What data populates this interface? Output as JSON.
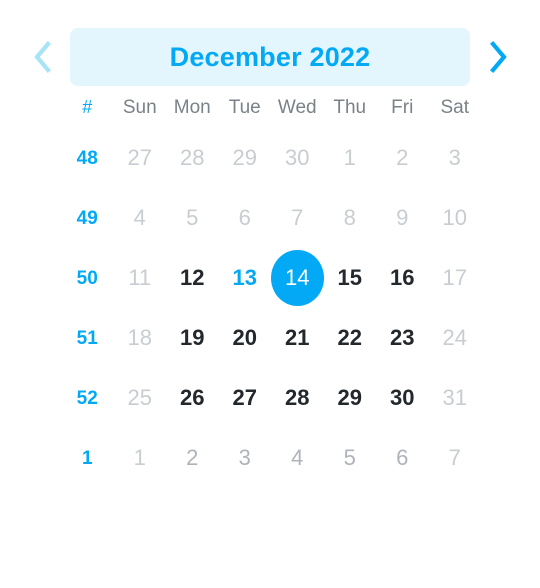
{
  "header": {
    "prev_icon": "chevron-left-icon",
    "next_icon": "chevron-right-icon",
    "title": "December 2022",
    "month": "December",
    "year": "2022"
  },
  "colors": {
    "accent": "#03a9f4",
    "accent_muted": "#a8e3f8",
    "header_pill_bg": "#e3f5fd",
    "day_text": "#23282c",
    "day_muted": "#c8cdd1",
    "dow_text": "#7a8288",
    "selected_text": "#ffffff",
    "background": "#ffffff"
  },
  "weekday_header": {
    "week_number_label": "#",
    "days": [
      "Sun",
      "Mon",
      "Tue",
      "Wed",
      "Thu",
      "Fri",
      "Sat"
    ]
  },
  "selected_date": "14",
  "today_date": "13",
  "weeks": [
    {
      "week_number": "48",
      "days": [
        {
          "label": "27",
          "state": "muted"
        },
        {
          "label": "28",
          "state": "muted"
        },
        {
          "label": "29",
          "state": "muted"
        },
        {
          "label": "30",
          "state": "muted"
        },
        {
          "label": "1",
          "state": "muted"
        },
        {
          "label": "2",
          "state": "muted"
        },
        {
          "label": "3",
          "state": "muted"
        }
      ]
    },
    {
      "week_number": "49",
      "days": [
        {
          "label": "4",
          "state": "muted"
        },
        {
          "label": "5",
          "state": "muted"
        },
        {
          "label": "6",
          "state": "muted"
        },
        {
          "label": "7",
          "state": "muted"
        },
        {
          "label": "8",
          "state": "muted"
        },
        {
          "label": "9",
          "state": "muted"
        },
        {
          "label": "10",
          "state": "muted"
        }
      ]
    },
    {
      "week_number": "50",
      "days": [
        {
          "label": "11",
          "state": "muted"
        },
        {
          "label": "12",
          "state": "normal"
        },
        {
          "label": "13",
          "state": "today"
        },
        {
          "label": "14",
          "state": "selected"
        },
        {
          "label": "15",
          "state": "normal"
        },
        {
          "label": "16",
          "state": "normal"
        },
        {
          "label": "17",
          "state": "muted"
        }
      ]
    },
    {
      "week_number": "51",
      "days": [
        {
          "label": "18",
          "state": "muted"
        },
        {
          "label": "19",
          "state": "normal"
        },
        {
          "label": "20",
          "state": "normal"
        },
        {
          "label": "21",
          "state": "normal"
        },
        {
          "label": "22",
          "state": "normal"
        },
        {
          "label": "23",
          "state": "normal"
        },
        {
          "label": "24",
          "state": "muted"
        }
      ]
    },
    {
      "week_number": "52",
      "days": [
        {
          "label": "25",
          "state": "muted"
        },
        {
          "label": "26",
          "state": "normal"
        },
        {
          "label": "27",
          "state": "normal"
        },
        {
          "label": "28",
          "state": "normal"
        },
        {
          "label": "29",
          "state": "normal"
        },
        {
          "label": "30",
          "state": "normal"
        },
        {
          "label": "31",
          "state": "muted"
        }
      ]
    },
    {
      "week_number": "1",
      "days": [
        {
          "label": "1",
          "state": "muted"
        },
        {
          "label": "2",
          "state": "muted-dark"
        },
        {
          "label": "3",
          "state": "muted-dark"
        },
        {
          "label": "4",
          "state": "muted-dark"
        },
        {
          "label": "5",
          "state": "muted-dark"
        },
        {
          "label": "6",
          "state": "muted-dark"
        },
        {
          "label": "7",
          "state": "muted"
        }
      ]
    }
  ]
}
